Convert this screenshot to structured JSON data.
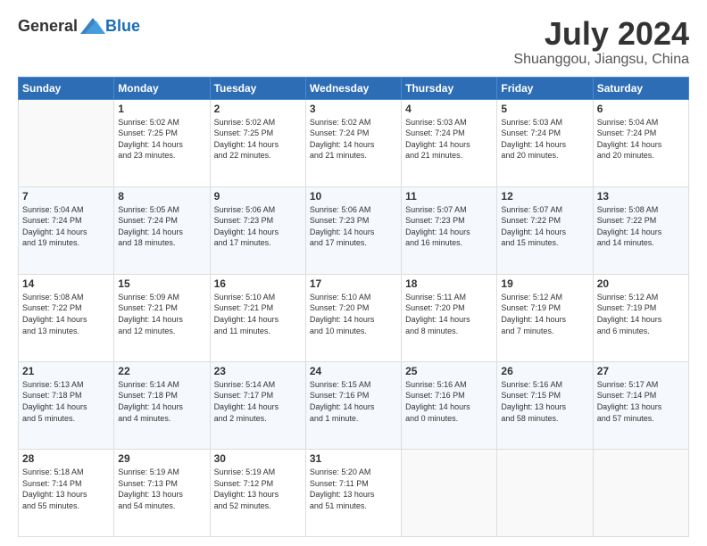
{
  "header": {
    "logo_general": "General",
    "logo_blue": "Blue",
    "month_title": "July 2024",
    "location": "Shuanggou, Jiangsu, China"
  },
  "weekdays": [
    "Sunday",
    "Monday",
    "Tuesday",
    "Wednesday",
    "Thursday",
    "Friday",
    "Saturday"
  ],
  "weeks": [
    [
      {
        "day": "",
        "info": ""
      },
      {
        "day": "1",
        "info": "Sunrise: 5:02 AM\nSunset: 7:25 PM\nDaylight: 14 hours\nand 23 minutes."
      },
      {
        "day": "2",
        "info": "Sunrise: 5:02 AM\nSunset: 7:25 PM\nDaylight: 14 hours\nand 22 minutes."
      },
      {
        "day": "3",
        "info": "Sunrise: 5:02 AM\nSunset: 7:24 PM\nDaylight: 14 hours\nand 21 minutes."
      },
      {
        "day": "4",
        "info": "Sunrise: 5:03 AM\nSunset: 7:24 PM\nDaylight: 14 hours\nand 21 minutes."
      },
      {
        "day": "5",
        "info": "Sunrise: 5:03 AM\nSunset: 7:24 PM\nDaylight: 14 hours\nand 20 minutes."
      },
      {
        "day": "6",
        "info": "Sunrise: 5:04 AM\nSunset: 7:24 PM\nDaylight: 14 hours\nand 20 minutes."
      }
    ],
    [
      {
        "day": "7",
        "info": "Sunrise: 5:04 AM\nSunset: 7:24 PM\nDaylight: 14 hours\nand 19 minutes."
      },
      {
        "day": "8",
        "info": "Sunrise: 5:05 AM\nSunset: 7:24 PM\nDaylight: 14 hours\nand 18 minutes."
      },
      {
        "day": "9",
        "info": "Sunrise: 5:06 AM\nSunset: 7:23 PM\nDaylight: 14 hours\nand 17 minutes."
      },
      {
        "day": "10",
        "info": "Sunrise: 5:06 AM\nSunset: 7:23 PM\nDaylight: 14 hours\nand 17 minutes."
      },
      {
        "day": "11",
        "info": "Sunrise: 5:07 AM\nSunset: 7:23 PM\nDaylight: 14 hours\nand 16 minutes."
      },
      {
        "day": "12",
        "info": "Sunrise: 5:07 AM\nSunset: 7:22 PM\nDaylight: 14 hours\nand 15 minutes."
      },
      {
        "day": "13",
        "info": "Sunrise: 5:08 AM\nSunset: 7:22 PM\nDaylight: 14 hours\nand 14 minutes."
      }
    ],
    [
      {
        "day": "14",
        "info": "Sunrise: 5:08 AM\nSunset: 7:22 PM\nDaylight: 14 hours\nand 13 minutes."
      },
      {
        "day": "15",
        "info": "Sunrise: 5:09 AM\nSunset: 7:21 PM\nDaylight: 14 hours\nand 12 minutes."
      },
      {
        "day": "16",
        "info": "Sunrise: 5:10 AM\nSunset: 7:21 PM\nDaylight: 14 hours\nand 11 minutes."
      },
      {
        "day": "17",
        "info": "Sunrise: 5:10 AM\nSunset: 7:20 PM\nDaylight: 14 hours\nand 10 minutes."
      },
      {
        "day": "18",
        "info": "Sunrise: 5:11 AM\nSunset: 7:20 PM\nDaylight: 14 hours\nand 8 minutes."
      },
      {
        "day": "19",
        "info": "Sunrise: 5:12 AM\nSunset: 7:19 PM\nDaylight: 14 hours\nand 7 minutes."
      },
      {
        "day": "20",
        "info": "Sunrise: 5:12 AM\nSunset: 7:19 PM\nDaylight: 14 hours\nand 6 minutes."
      }
    ],
    [
      {
        "day": "21",
        "info": "Sunrise: 5:13 AM\nSunset: 7:18 PM\nDaylight: 14 hours\nand 5 minutes."
      },
      {
        "day": "22",
        "info": "Sunrise: 5:14 AM\nSunset: 7:18 PM\nDaylight: 14 hours\nand 4 minutes."
      },
      {
        "day": "23",
        "info": "Sunrise: 5:14 AM\nSunset: 7:17 PM\nDaylight: 14 hours\nand 2 minutes."
      },
      {
        "day": "24",
        "info": "Sunrise: 5:15 AM\nSunset: 7:16 PM\nDaylight: 14 hours\nand 1 minute."
      },
      {
        "day": "25",
        "info": "Sunrise: 5:16 AM\nSunset: 7:16 PM\nDaylight: 14 hours\nand 0 minutes."
      },
      {
        "day": "26",
        "info": "Sunrise: 5:16 AM\nSunset: 7:15 PM\nDaylight: 13 hours\nand 58 minutes."
      },
      {
        "day": "27",
        "info": "Sunrise: 5:17 AM\nSunset: 7:14 PM\nDaylight: 13 hours\nand 57 minutes."
      }
    ],
    [
      {
        "day": "28",
        "info": "Sunrise: 5:18 AM\nSunset: 7:14 PM\nDaylight: 13 hours\nand 55 minutes."
      },
      {
        "day": "29",
        "info": "Sunrise: 5:19 AM\nSunset: 7:13 PM\nDaylight: 13 hours\nand 54 minutes."
      },
      {
        "day": "30",
        "info": "Sunrise: 5:19 AM\nSunset: 7:12 PM\nDaylight: 13 hours\nand 52 minutes."
      },
      {
        "day": "31",
        "info": "Sunrise: 5:20 AM\nSunset: 7:11 PM\nDaylight: 13 hours\nand 51 minutes."
      },
      {
        "day": "",
        "info": ""
      },
      {
        "day": "",
        "info": ""
      },
      {
        "day": "",
        "info": ""
      }
    ]
  ]
}
